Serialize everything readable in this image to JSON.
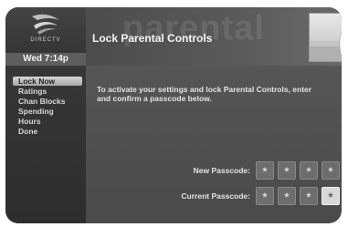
{
  "brand": {
    "logo_text": "DIRECTV"
  },
  "clock": {
    "datetime": "Wed 7:14p"
  },
  "header": {
    "watermark": "parental",
    "title": "Lock Parental Controls"
  },
  "sidebar": {
    "items": [
      {
        "label": "Lock Now",
        "selected": true
      },
      {
        "label": "Ratings",
        "selected": false
      },
      {
        "label": "Chan Blocks",
        "selected": false
      },
      {
        "label": "Spending",
        "selected": false
      },
      {
        "label": "Hours",
        "selected": false
      },
      {
        "label": "Done",
        "selected": false
      }
    ]
  },
  "main": {
    "instructions": "To activate your settings and lock Parental Controls, enter and confirm a passcode below.",
    "new_passcode": {
      "label": "New Passcode:",
      "digits": [
        "*",
        "*",
        "*",
        "*"
      ]
    },
    "current_passcode": {
      "label": "Current Passcode:",
      "digits": [
        "*",
        "*",
        "*",
        "*"
      ],
      "active_index": 3
    }
  },
  "colors": {
    "background": "#4e4e4e",
    "selected_item": "#d0d0d0",
    "text": "#e4e4e4"
  }
}
